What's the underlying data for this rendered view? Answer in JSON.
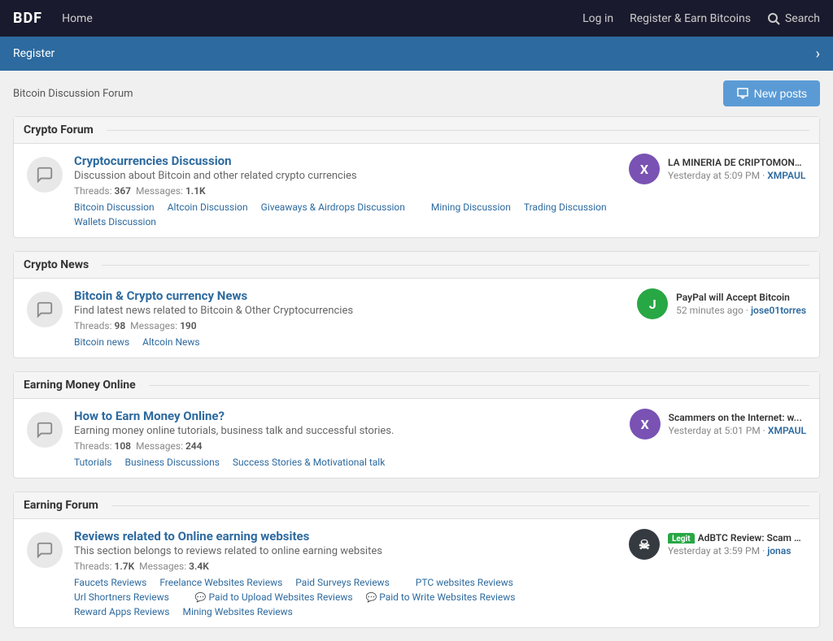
{
  "nav": {
    "logo": "BDF",
    "home": "Home",
    "login": "Log in",
    "register_earn": "Register & Earn Bitcoins",
    "search": "Search"
  },
  "register_banner": {
    "text": "Register",
    "chevron": "›"
  },
  "header": {
    "breadcrumb": "Bitcoin Discussion Forum",
    "new_posts": "New posts"
  },
  "sections": [
    {
      "id": "crypto-forum",
      "title": "Crypto Forum",
      "forums": [
        {
          "title": "Cryptocurrencies Discussion",
          "desc": "Discussion about Bitcoin and other related crypto currencies",
          "threads_label": "Threads:",
          "threads": "367",
          "messages_label": "Messages:",
          "messages": "1.1K",
          "sublinks": [
            {
              "label": "Bitcoin Discussion",
              "icon": false
            },
            {
              "label": "Altcoin Discussion",
              "icon": false
            },
            {
              "label": "Giveaways & Airdrops Discussion",
              "icon": false
            },
            {
              "label": "Mining Discussion",
              "icon": false
            },
            {
              "label": "Trading Discussion",
              "icon": false
            },
            {
              "label": "Wallets Discussion",
              "icon": false
            }
          ],
          "last_post_title": "LA MINERIA DE CRIPTOMONEDA...",
          "last_post_time": "Yesterday at 5:09 PM",
          "last_post_user": "XMPAUL",
          "avatar_letter": "X",
          "avatar_class": "avatar-purple"
        }
      ]
    },
    {
      "id": "crypto-news",
      "title": "Crypto News",
      "forums": [
        {
          "title": "Bitcoin & Crypto currency News",
          "desc": "Find latest news related to Bitcoin & Other Cryptocurrencies",
          "threads_label": "Threads:",
          "threads": "98",
          "messages_label": "Messages:",
          "messages": "190",
          "sublinks": [
            {
              "label": "Bitcoin news",
              "icon": false
            },
            {
              "label": "Altcoin News",
              "icon": false
            }
          ],
          "last_post_title": "PayPal will Accept Bitcoin",
          "last_post_time": "52 minutes ago",
          "last_post_user": "jose01torres",
          "avatar_letter": "J",
          "avatar_class": "avatar-green"
        }
      ]
    },
    {
      "id": "earning-money-online",
      "title": "Earning Money Online",
      "forums": [
        {
          "title": "How to Earn Money Online?",
          "desc": "Earning money online tutorials, business talk and successful stories.",
          "threads_label": "Threads:",
          "threads": "108",
          "messages_label": "Messages:",
          "messages": "244",
          "sublinks": [
            {
              "label": "Tutorials",
              "icon": false
            },
            {
              "label": "Business Discussions",
              "icon": false
            },
            {
              "label": "Success Stories & Motivational talk",
              "icon": false
            }
          ],
          "last_post_title": "Scammers on the Internet: w...",
          "last_post_time": "Yesterday at 5:01 PM",
          "last_post_user": "XMPAUL",
          "avatar_letter": "X",
          "avatar_class": "avatar-purple"
        }
      ]
    },
    {
      "id": "earning-forum",
      "title": "Earning Forum",
      "forums": [
        {
          "title": "Reviews related to Online earning websites",
          "desc": "This section belongs to reviews related to online earning websites",
          "threads_label": "Threads:",
          "threads": "1.7K",
          "messages_label": "Messages:",
          "messages": "3.4K",
          "sublinks": [
            {
              "label": "Faucets Reviews",
              "icon": false
            },
            {
              "label": "Freelance Websites Reviews",
              "icon": false
            },
            {
              "label": "Paid Surveys Reviews",
              "icon": false
            },
            {
              "label": "PTC websites Reviews",
              "icon": false
            },
            {
              "label": "Url Shortners Reviews",
              "icon": false
            },
            {
              "label": "Paid to Upload Websites Reviews",
              "icon": true
            },
            {
              "label": "Paid to Write Websites Reviews",
              "icon": true
            },
            {
              "label": "Reward Apps Reviews",
              "icon": false
            },
            {
              "label": "Mining Websites Reviews",
              "icon": false
            }
          ],
          "badge": "Legit",
          "last_post_title": "AdBTC Review: Scam or...",
          "last_post_time": "Yesterday at 3:59 PM",
          "last_post_user": "jonas",
          "avatar_letter": "☠",
          "avatar_class": "avatar-dark"
        }
      ]
    }
  ]
}
